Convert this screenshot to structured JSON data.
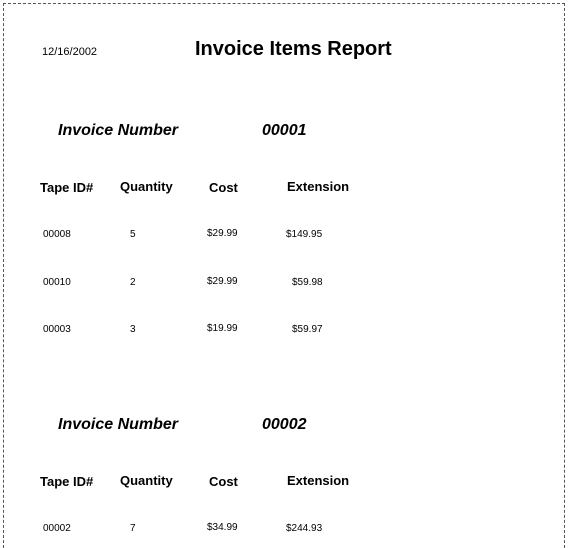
{
  "report": {
    "date": "12/16/2002",
    "title": "Invoice Items Report",
    "columns": [
      "Tape ID#",
      "Quantity",
      "Cost",
      "Extension"
    ],
    "groups": [
      {
        "label": "Invoice Number",
        "number": "00001",
        "rows": [
          {
            "tape_id": "00008",
            "quantity": "5",
            "cost": "$29.99",
            "extension": "$149.95"
          },
          {
            "tape_id": "00010",
            "quantity": "2",
            "cost": "$29.99",
            "extension": "$59.98"
          },
          {
            "tape_id": "00003",
            "quantity": "3",
            "cost": "$19.99",
            "extension": "$59.97"
          }
        ]
      },
      {
        "label": "Invoice Number",
        "number": "00002",
        "rows": [
          {
            "tape_id": "00002",
            "quantity": "7",
            "cost": "$34.99",
            "extension": "$244.93"
          }
        ]
      }
    ]
  }
}
